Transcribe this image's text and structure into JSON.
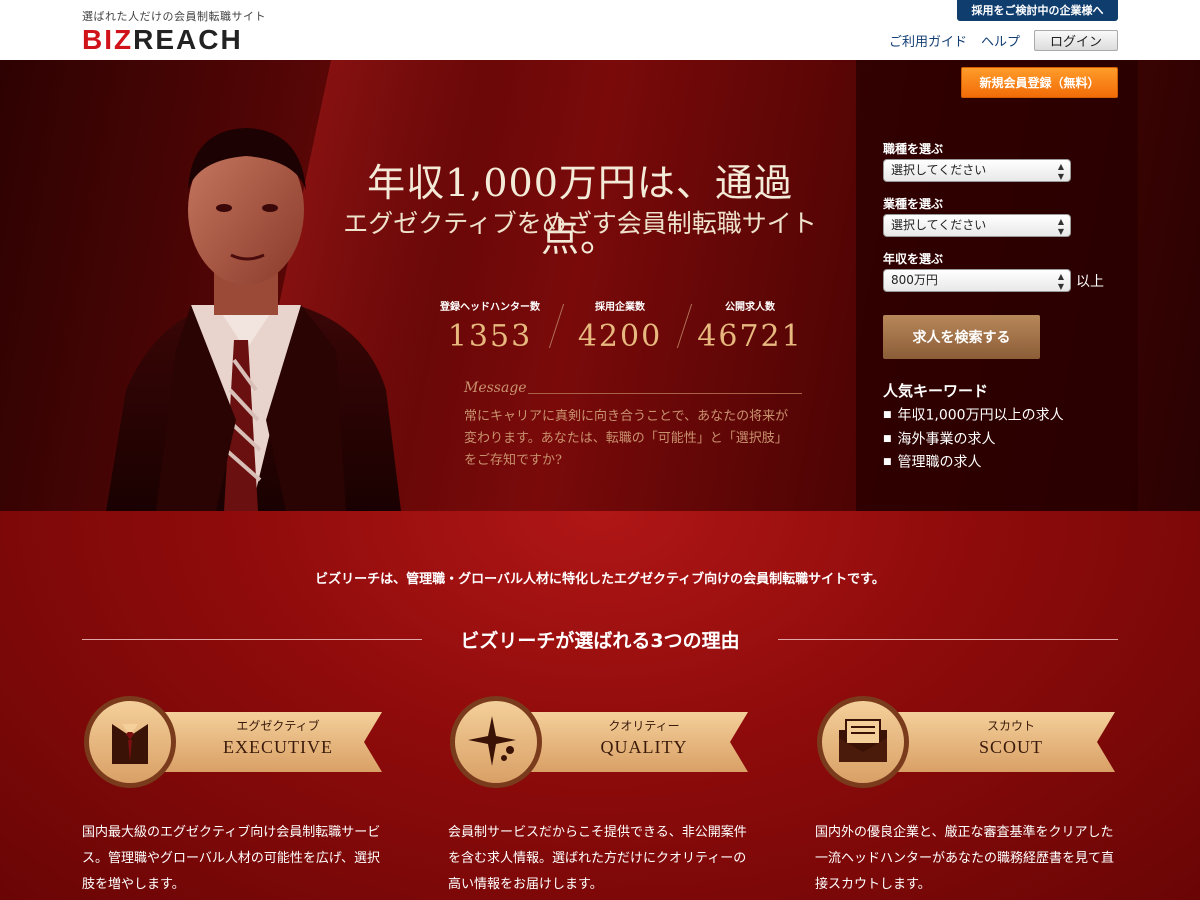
{
  "header": {
    "tagline": "選ばれた人だけの会員制転職サイト",
    "logo_red": "BIZ",
    "logo_dark": "REACH",
    "corporate_link": "採用をご検討中の企業様へ",
    "nav": {
      "guide": "ご利用ガイド",
      "help": "ヘルプ",
      "login": "ログイン"
    }
  },
  "hero": {
    "title": "年収1,000万円は、通過点。",
    "subtitle": "エグゼクティブをめざす会員制転職サイト",
    "stats": [
      {
        "label": "登録ヘッドハンター数",
        "value": "1353"
      },
      {
        "label": "採用企業数",
        "value": "4200"
      },
      {
        "label": "公開求人数",
        "value": "46721"
      }
    ],
    "message_heading": "Message",
    "message_text": "常にキャリアに真剣に向き合うことで、あなたの将来が変わります。あなたは、転職の「可能性」と「選択肢」をご存知ですか?"
  },
  "search": {
    "register_button": "新規会員登録（無料）",
    "job_type_label": "職種を選ぶ",
    "job_type_value": "選択してください",
    "industry_label": "業種を選ぶ",
    "industry_value": "選択してください",
    "salary_label": "年収を選ぶ",
    "salary_value": "800万円",
    "salary_suffix": "以上",
    "search_button": "求人を検索する",
    "keywords_title": "人気キーワード",
    "keywords": [
      "年収1,000万円以上の求人",
      "海外事業の求人",
      "管理職の求人"
    ]
  },
  "lower": {
    "intro": "ビズリーチは、管理職・グローバル人材に特化したエグゼクティブ向けの会員制転職サイトです。",
    "reasons_title": "ビズリーチが選ばれる3つの理由",
    "features": [
      {
        "jp": "エグゼクティブ",
        "en": "EXECUTIVE",
        "icon": "tuxedo-icon",
        "desc": "国内最大級のエグゼクティブ向け会員制転職サービス。管理職やグローバル人材の可能性を広げ、選択肢を増やします。"
      },
      {
        "jp": "クオリティー",
        "en": "QUALITY",
        "icon": "sparkle-icon",
        "desc": "会員制サービスだからこそ提供できる、非公開案件を含む求人情報。選ばれた方だけにクオリティーの高い情報をお届けします。"
      },
      {
        "jp": "スカウト",
        "en": "SCOUT",
        "icon": "envelope-icon",
        "desc": "国内外の優良企業と、厳正な審査基準をクリアした一流ヘッドハンターがあなたの職務経歴書を見て直接スカウトします。"
      }
    ]
  },
  "colors": {
    "brand_red": "#d0121b",
    "navy": "#0e3d6e",
    "orange": "#f26c08",
    "gold": "#e7b97f"
  }
}
